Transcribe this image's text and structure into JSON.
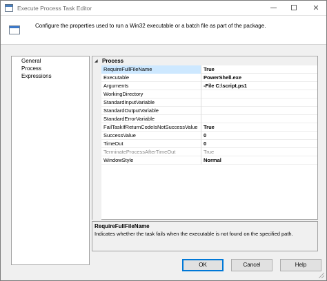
{
  "window": {
    "title": "Execute Process Task Editor",
    "close_glyph": "✕"
  },
  "header": {
    "description": "Configure the properties used to run a Win32 executable or a batch file as part of the package."
  },
  "nav": {
    "items": [
      {
        "label": "General"
      },
      {
        "label": "Process"
      },
      {
        "label": "Expressions"
      }
    ]
  },
  "grid": {
    "category": "Process",
    "toggle_glyph": "◢",
    "properties": [
      {
        "name": "RequireFullFileName",
        "value": "True"
      },
      {
        "name": "Executable",
        "value": "PowerShell.exe"
      },
      {
        "name": "Arguments",
        "value": "-File C:\\script.ps1"
      },
      {
        "name": "WorkingDirectory",
        "value": ""
      },
      {
        "name": "StandardInputVariable",
        "value": ""
      },
      {
        "name": "StandardOutputVariable",
        "value": ""
      },
      {
        "name": "StandardErrorVariable",
        "value": ""
      },
      {
        "name": "FailTaskIfReturnCodeIsNotSuccessValue",
        "value": "True"
      },
      {
        "name": "SuccessValue",
        "value": "0"
      },
      {
        "name": "TimeOut",
        "value": "0"
      },
      {
        "name": "TerminateProcessAfterTimeOut",
        "value": "True"
      },
      {
        "name": "WindowStyle",
        "value": "Normal"
      }
    ]
  },
  "description_pane": {
    "title": "RequireFullFileName",
    "body": "Indicates whether the task fails when the executable is not found on the specified path."
  },
  "buttons": {
    "ok": "OK",
    "cancel": "Cancel",
    "help": "Help"
  }
}
